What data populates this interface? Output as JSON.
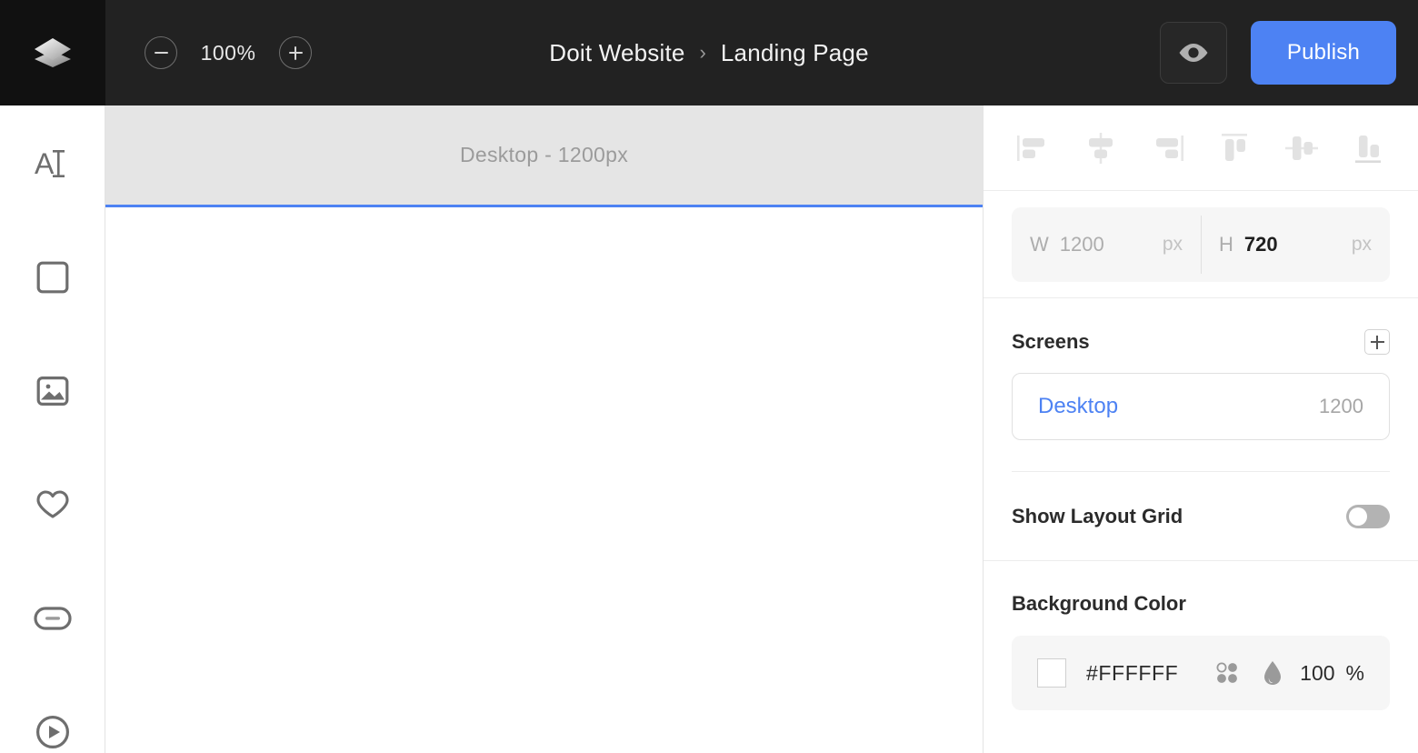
{
  "app": {
    "logo_icon": "layers-stack-logo"
  },
  "topbar": {
    "zoom_out_icon": "minus-icon",
    "zoom_in_icon": "plus-icon",
    "zoom_level": "100%",
    "breadcrumb": {
      "parent": "Doit Website",
      "separator": "›",
      "current": "Landing Page"
    },
    "preview_icon": "eye-icon",
    "publish_label": "Publish",
    "accent_color": "#4D82F3",
    "bar_color": "#222222",
    "logo_cell_color": "#111111"
  },
  "left_toolbar": {
    "items": [
      {
        "name": "text-tool",
        "icon": "text-cursor-icon"
      },
      {
        "name": "shape-tool",
        "icon": "square-icon"
      },
      {
        "name": "image-tool",
        "icon": "image-icon"
      },
      {
        "name": "favorites-tool",
        "icon": "heart-icon"
      },
      {
        "name": "button-tool",
        "icon": "button-pill-icon"
      },
      {
        "name": "video-tool",
        "icon": "play-circle-icon"
      }
    ]
  },
  "canvas": {
    "screen_label": "Desktop - 1200px",
    "header_bg": "#E5E5E5",
    "selection_color": "#4D82F3",
    "body_bg": "#FFFFFF"
  },
  "right_panel": {
    "align_buttons": [
      {
        "name": "align-left",
        "icon": "align-left-icon"
      },
      {
        "name": "align-center-horizontal",
        "icon": "align-center-h-icon"
      },
      {
        "name": "align-right",
        "icon": "align-right-icon"
      },
      {
        "name": "align-top",
        "icon": "align-top-icon"
      },
      {
        "name": "align-center-vertical",
        "icon": "align-center-v-icon"
      },
      {
        "name": "align-bottom",
        "icon": "align-bottom-icon"
      }
    ],
    "dimensions": {
      "width_label": "W",
      "width_value": "1200",
      "width_unit": "px",
      "height_label": "H",
      "height_value": "720",
      "height_unit": "px"
    },
    "screens": {
      "title": "Screens",
      "add_icon": "plus-icon",
      "items": [
        {
          "name": "Desktop",
          "width": "1200"
        }
      ]
    },
    "layout_grid": {
      "label": "Show Layout Grid",
      "enabled": false
    },
    "background_color": {
      "title": "Background Color",
      "hex": "#FFFFFF",
      "swatch_color": "#FFFFFF",
      "picker_icon": "color-palette-dots-icon",
      "opacity_icon": "water-drop-icon",
      "opacity_value": "100",
      "opacity_unit": "%"
    }
  }
}
